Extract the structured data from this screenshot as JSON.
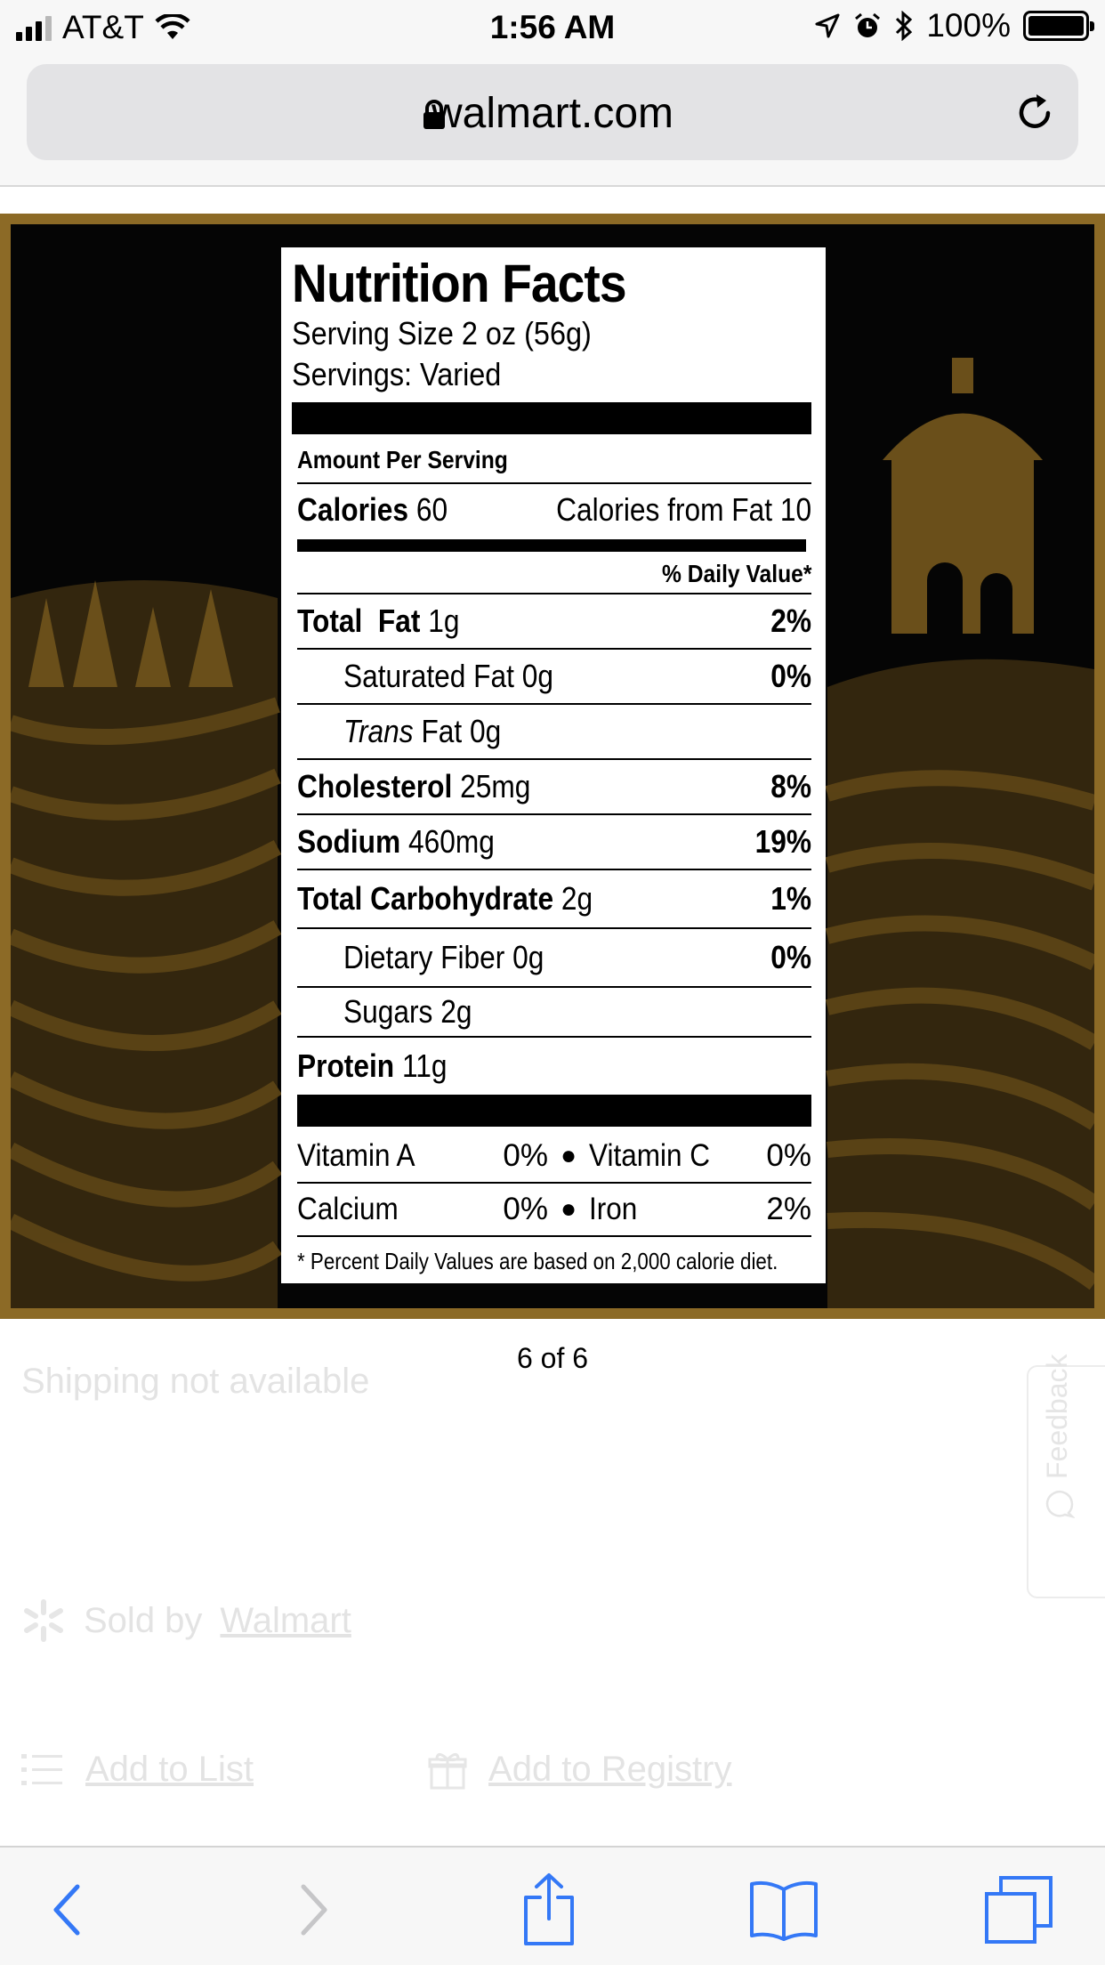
{
  "status_bar": {
    "carrier": "AT&T",
    "time": "1:56 AM",
    "battery": "100%"
  },
  "browser": {
    "url": "walmart.com"
  },
  "nutrition": {
    "title": "Nutrition Facts",
    "serving_size": "Serving Size 2 oz (56g)",
    "servings": "Servings: Varied",
    "amount_per_serving": "Amount Per Serving",
    "calories_label": "Calories",
    "calories_value": "60",
    "calories_from_fat": "Calories from Fat 10",
    "daily_value_header": "% Daily Value*",
    "rows": [
      {
        "label": "Total  Fat",
        "amount": "1g",
        "dv": "2%"
      },
      {
        "label": "Saturated Fat",
        "amount": "0g",
        "dv": "0%"
      },
      {
        "label_italic": "Trans",
        "label": "Fat",
        "amount": "0g",
        "dv": ""
      },
      {
        "label": "Cholesterol",
        "amount": "25mg",
        "dv": "8%"
      },
      {
        "label": "Sodium",
        "amount": "460mg",
        "dv": "19%"
      },
      {
        "label": "Total Carbohydrate",
        "amount": "2g",
        "dv": "1%"
      },
      {
        "label": "Dietary Fiber",
        "amount": "0g",
        "dv": "0%"
      },
      {
        "label": "Sugars",
        "amount": "2g",
        "dv": ""
      },
      {
        "label": "Protein",
        "amount": "11g",
        "dv": ""
      }
    ],
    "vitamins": [
      {
        "name1": "Vitamin A",
        "pct1": "0%",
        "name2": "Vitamin C",
        "pct2": "0%"
      },
      {
        "name1": "Calcium",
        "pct1": "0%",
        "name2": "Iron",
        "pct2": "2%"
      }
    ],
    "bullet": "●",
    "footnote": "* Percent Daily Values are based on 2,000 calorie diet."
  },
  "carousel": {
    "page_indicator": "6 of 6"
  },
  "page": {
    "shipping": "Shipping not available",
    "feedback": "Feedback",
    "sold_by_label": "Sold by",
    "sold_by_seller": "Walmart",
    "add_to_list": "Add to List",
    "add_to_registry": "Add to Registry"
  },
  "colors": {
    "frame_gold": "#8c6a26",
    "ios_blue": "#3478f6"
  }
}
